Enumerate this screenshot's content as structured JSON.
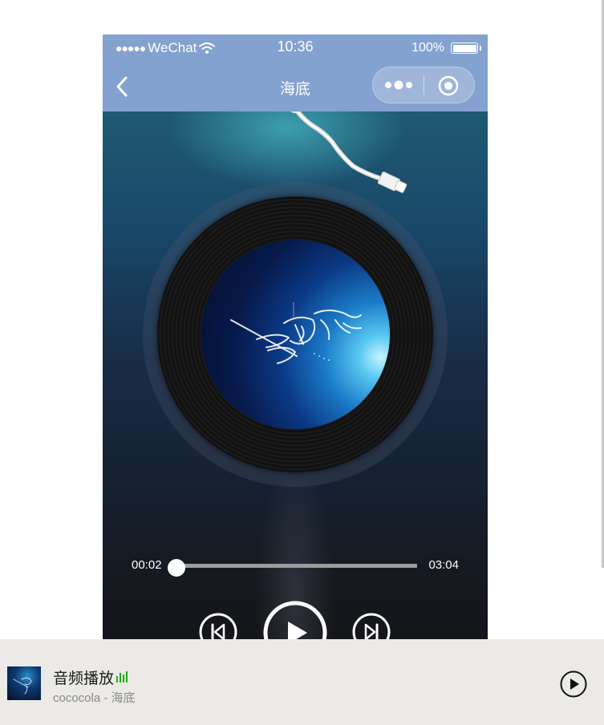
{
  "status_bar": {
    "signal_dots": "●●●●●",
    "carrier": "WeChat",
    "time": "10:36",
    "battery": "100%"
  },
  "nav": {
    "title": "海底"
  },
  "player": {
    "current_time": "00:02",
    "total_time": "03:04",
    "progress": 0.011,
    "cover_art_text": "海底"
  },
  "mini_player": {
    "title": "音频播放",
    "artist": "cococola",
    "separator": " - ",
    "song": "海底"
  },
  "colors": {
    "nav_background": "#84a2d0",
    "mini_background": "#ebeae6",
    "equalizer": "#1aad19",
    "track": "#9c9c9c"
  },
  "icons": [
    "wifi-icon",
    "battery-icon",
    "back-icon",
    "more-icon",
    "close-target-icon",
    "tonearm-icon",
    "prev-icon",
    "play-icon",
    "next-icon",
    "equalizer-icon",
    "mini-play-icon"
  ]
}
